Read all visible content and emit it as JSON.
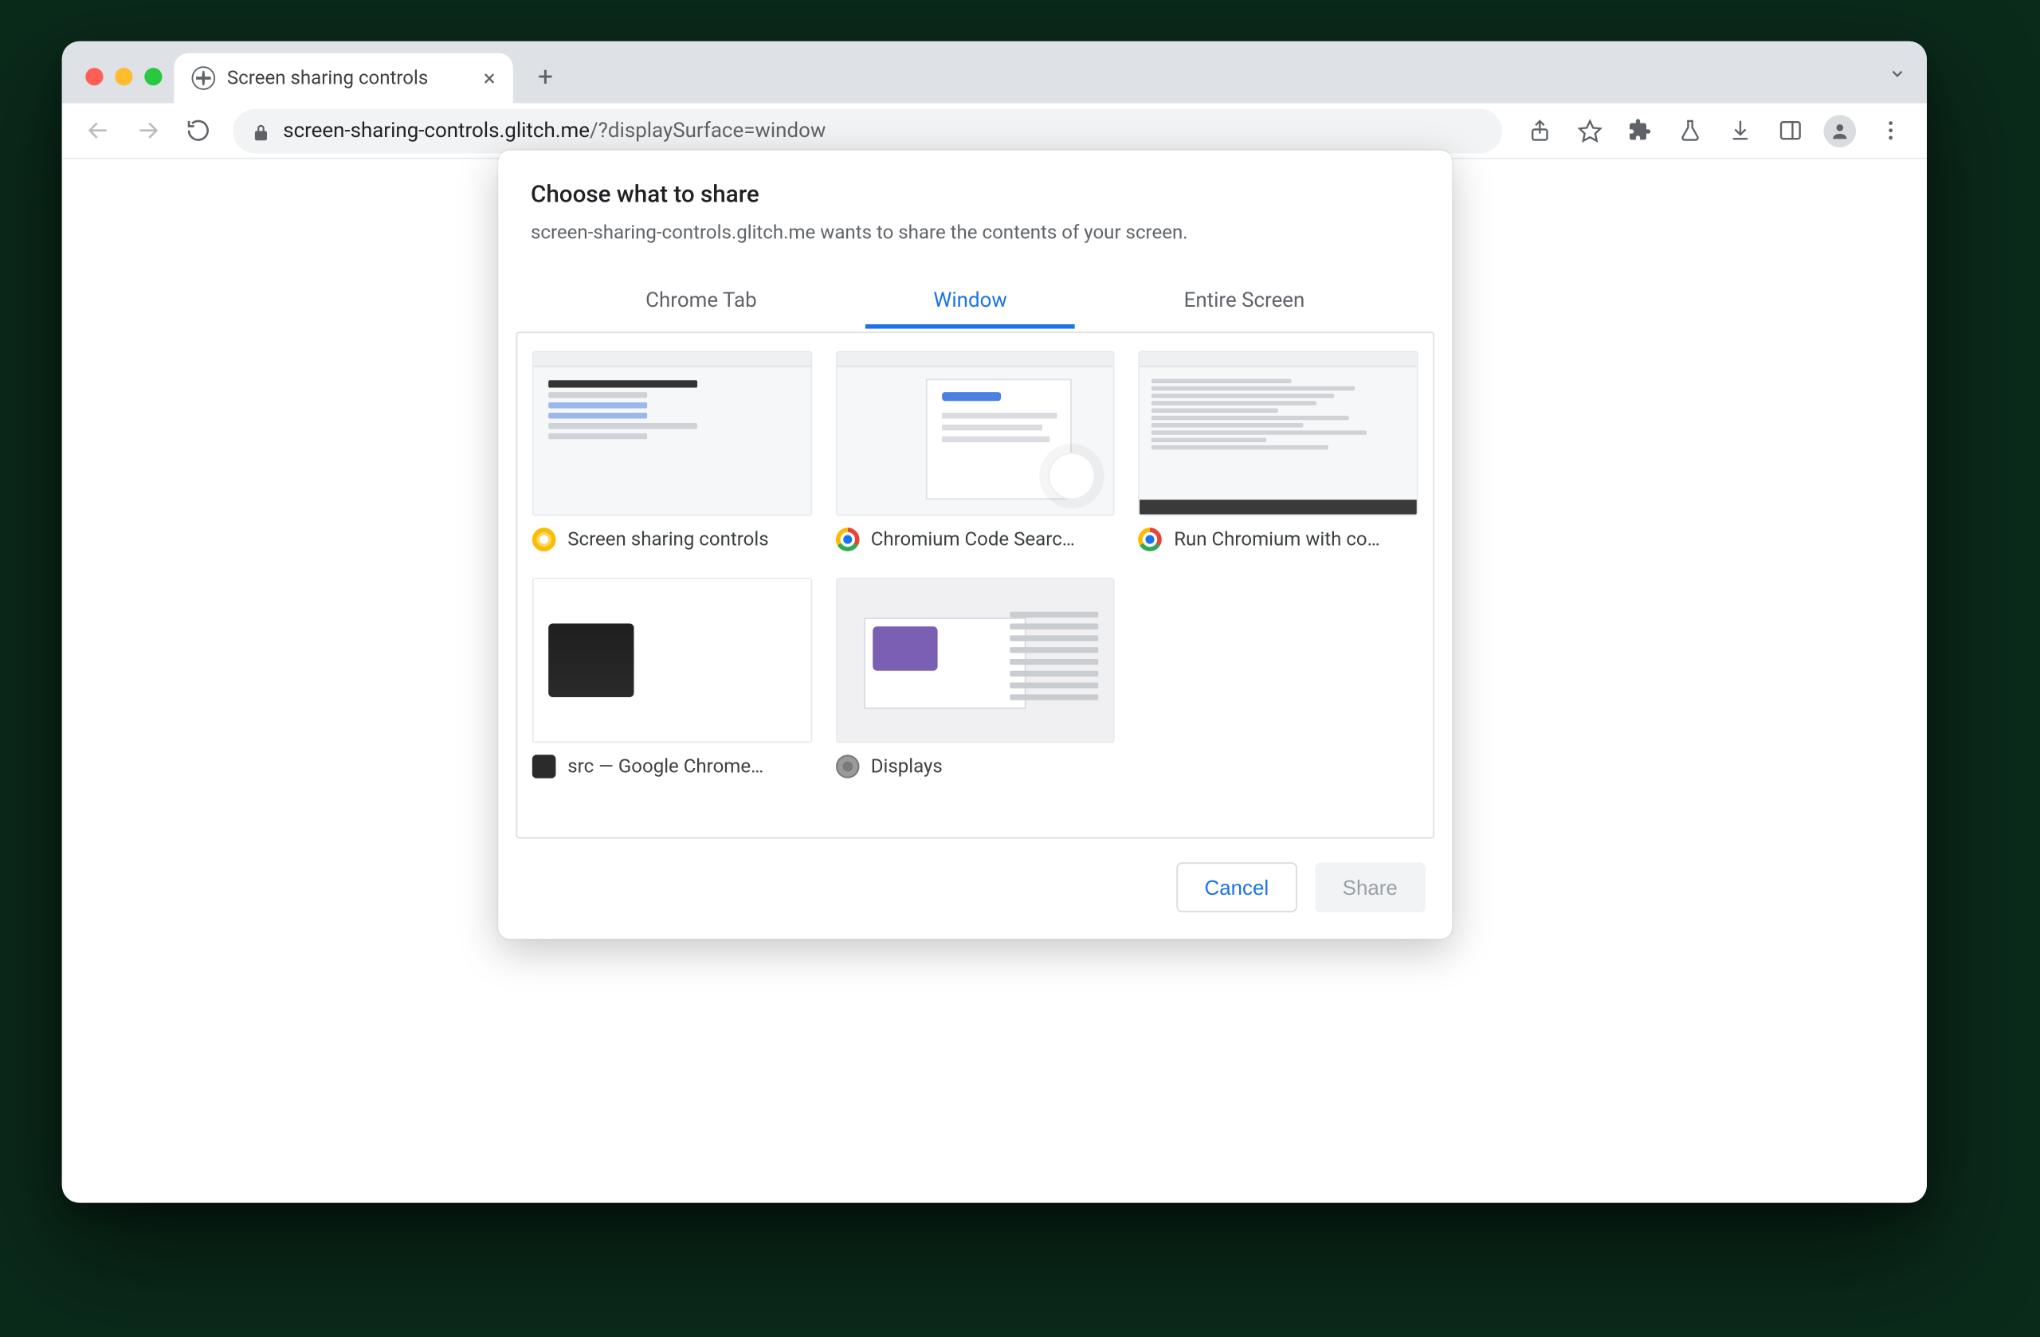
{
  "tab": {
    "title": "Screen sharing controls"
  },
  "address": {
    "host": "screen-sharing-controls.glitch.me",
    "path": "/?displaySurface=window"
  },
  "dialog": {
    "title": "Choose what to share",
    "subtitle": "screen-sharing-controls.glitch.me wants to share the contents of your screen.",
    "tabs": {
      "chrome_tab": "Chrome Tab",
      "window": "Window",
      "entire_screen": "Entire Screen",
      "active": "window"
    },
    "windows": [
      {
        "label": "Screen sharing controls",
        "app": "canary"
      },
      {
        "label": "Chromium Code Searc…",
        "app": "chrome"
      },
      {
        "label": "Run Chromium with co…",
        "app": "chrome"
      },
      {
        "label": "src — Google Chrome…",
        "app": "terminal"
      },
      {
        "label": "Displays",
        "app": "settings"
      }
    ],
    "actions": {
      "cancel": "Cancel",
      "share": "Share"
    }
  }
}
